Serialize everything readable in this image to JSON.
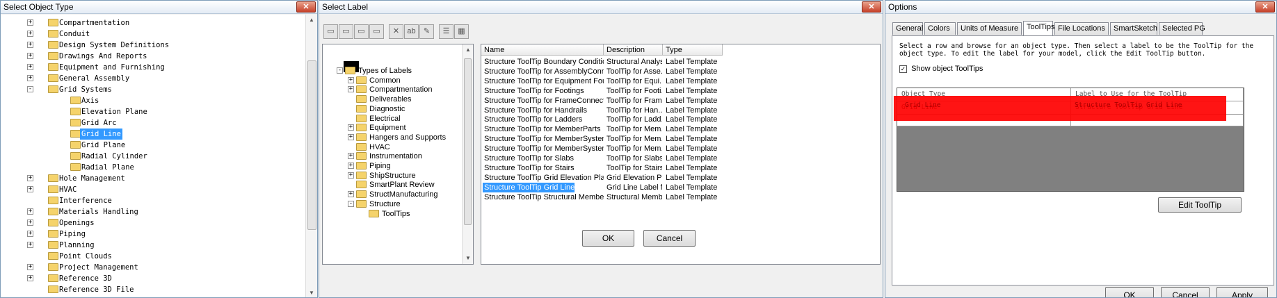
{
  "window1": {
    "title": "Select Object Type",
    "tree": [
      {
        "label": "Compartmentation",
        "level": 0,
        "expander": "+"
      },
      {
        "label": "Conduit",
        "level": 0,
        "expander": "+"
      },
      {
        "label": "Design System Definitions",
        "level": 0,
        "expander": "+"
      },
      {
        "label": "Drawings And Reports",
        "level": 0,
        "expander": "+"
      },
      {
        "label": "Equipment and Furnishing",
        "level": 0,
        "expander": "+"
      },
      {
        "label": "General Assembly",
        "level": 0,
        "expander": "+"
      },
      {
        "label": "Grid Systems",
        "level": 0,
        "expander": "-"
      },
      {
        "label": "Axis",
        "level": 1,
        "expander": ""
      },
      {
        "label": "Elevation Plane",
        "level": 1,
        "expander": ""
      },
      {
        "label": "Grid Arc",
        "level": 1,
        "expander": ""
      },
      {
        "label": "Grid Line",
        "level": 1,
        "expander": "",
        "selected": true
      },
      {
        "label": "Grid Plane",
        "level": 1,
        "expander": ""
      },
      {
        "label": "Radial Cylinder",
        "level": 1,
        "expander": ""
      },
      {
        "label": "Radial Plane",
        "level": 1,
        "expander": ""
      },
      {
        "label": "Hole Management",
        "level": 0,
        "expander": "+"
      },
      {
        "label": "HVAC",
        "level": 0,
        "expander": "+"
      },
      {
        "label": "Interference",
        "level": 0,
        "expander": ""
      },
      {
        "label": "Materials Handling",
        "level": 0,
        "expander": "+"
      },
      {
        "label": "Openings",
        "level": 0,
        "expander": "+"
      },
      {
        "label": "Piping",
        "level": 0,
        "expander": "+"
      },
      {
        "label": "Planning",
        "level": 0,
        "expander": "+"
      },
      {
        "label": "Point Clouds",
        "level": 0,
        "expander": ""
      },
      {
        "label": "Project Management",
        "level": 0,
        "expander": "+"
      },
      {
        "label": "Reference 3D",
        "level": 0,
        "expander": "+"
      },
      {
        "label": "Reference 3D File",
        "level": 0,
        "expander": ""
      }
    ]
  },
  "window2": {
    "title": "Select Label",
    "tree": [
      {
        "label": "Types of Labels",
        "level": 0,
        "expander": "-"
      },
      {
        "label": "Common",
        "level": 1,
        "expander": "+"
      },
      {
        "label": "Compartmentation",
        "level": 1,
        "expander": "+"
      },
      {
        "label": "Deliverables",
        "level": 1,
        "expander": ""
      },
      {
        "label": "Diagnostic",
        "level": 1,
        "expander": ""
      },
      {
        "label": "Electrical",
        "level": 1,
        "expander": ""
      },
      {
        "label": "Equipment",
        "level": 1,
        "expander": "+"
      },
      {
        "label": "Hangers and Supports",
        "level": 1,
        "expander": "+"
      },
      {
        "label": "HVAC",
        "level": 1,
        "expander": ""
      },
      {
        "label": "Instrumentation",
        "level": 1,
        "expander": "+"
      },
      {
        "label": "Piping",
        "level": 1,
        "expander": "+"
      },
      {
        "label": "ShipStructure",
        "level": 1,
        "expander": "+"
      },
      {
        "label": "SmartPlant Review",
        "level": 1,
        "expander": ""
      },
      {
        "label": "StructManufacturing",
        "level": 1,
        "expander": "+"
      },
      {
        "label": "Structure",
        "level": 1,
        "expander": "-"
      },
      {
        "label": "ToolTips",
        "level": 2,
        "expander": ""
      }
    ],
    "columns": [
      "Name",
      "Description",
      "Type"
    ],
    "rows": [
      [
        "Structure ToolTip Boundary Condition",
        "Structural Analys...",
        "Label Template"
      ],
      [
        "Structure ToolTip for AssemblyConnecti...",
        "ToolTip for Asse...",
        "Label Template"
      ],
      [
        "Structure ToolTip for Equipment Founda...",
        "ToolTip for Equi...",
        "Label Template"
      ],
      [
        "Structure ToolTip for Footings",
        "ToolTip for Footi...",
        "Label Template"
      ],
      [
        "Structure ToolTip for FrameConnections",
        "ToolTip for Fram...",
        "Label Template"
      ],
      [
        "Structure ToolTip for Handrails",
        "ToolTip for Han...",
        "Label Template"
      ],
      [
        "Structure ToolTip for Ladders",
        "ToolTip for Ladd...",
        "Label Template"
      ],
      [
        "Structure ToolTip for MemberParts",
        "ToolTip for Mem...",
        "Label Template"
      ],
      [
        "Structure ToolTip for MemberSystem Lo...",
        "ToolTip for Mem...",
        "Label Template"
      ],
      [
        "Structure ToolTip for MemberSystems",
        "ToolTip for Mem...",
        "Label Template"
      ],
      [
        "Structure ToolTip for Slabs",
        "ToolTip for Slabs",
        "Label Template"
      ],
      [
        "Structure ToolTip for Stairs",
        "ToolTip for Stairs",
        "Label Template"
      ],
      [
        "Structure ToolTip Grid Elevation Plane",
        "Grid Elevation Pl...",
        "Label Template"
      ],
      [
        "Structure ToolTip Grid Line",
        "Grid Line Label f...",
        "Label Template"
      ],
      [
        "Structure ToolTip Structural Member",
        "Structural Memb...",
        "Label Template"
      ]
    ],
    "selected_row": 13,
    "ok_label": "OK",
    "cancel_label": "Cancel"
  },
  "window3": {
    "title": "Options",
    "tabs": [
      "General",
      "Colors",
      "Units of Measure",
      "ToolTips",
      "File Locations",
      "SmartSketch",
      "Selected PG"
    ],
    "active_tab": 3,
    "instructions": "Select a row and browse for an object type. Then select a label to be the ToolTip for the object type. To edit the label for your model, click the Edit ToolTip button.",
    "show_tooltips_label": "Show object ToolTips",
    "show_tooltips_checked": true,
    "grid_headers": [
      "Object Type",
      "Label to Use for the ToolTip"
    ],
    "grid_rows": [
      [
        "Grid Line",
        "Structure ToolTip Grid Line"
      ]
    ],
    "edit_tooltip_label": "Edit ToolTip",
    "ok_label": "OK",
    "cancel_label": "Cancel",
    "apply_label": "Apply"
  },
  "colors": {
    "selection": "#3399ff",
    "redacted": "#ff0000"
  }
}
